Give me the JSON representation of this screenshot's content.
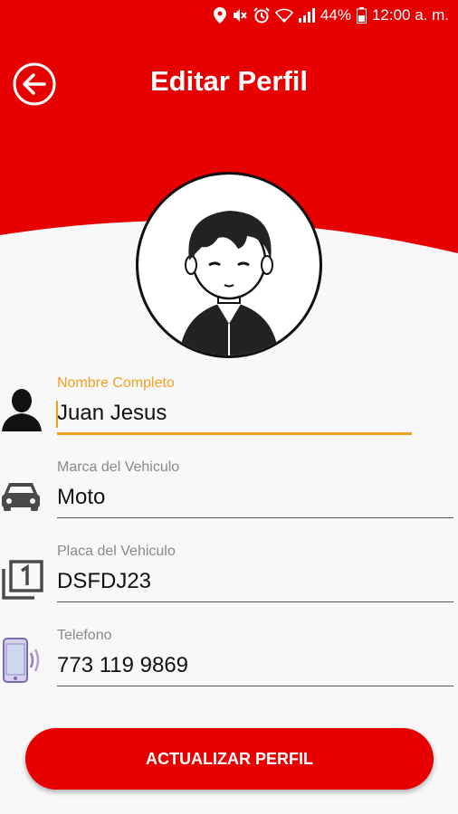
{
  "status_bar": {
    "battery": "44%",
    "time": "12:00 a. m.",
    "icons": [
      "location-icon",
      "mute-icon",
      "alarm-icon",
      "wifi-icon",
      "signal-icon",
      "battery-icon"
    ]
  },
  "header": {
    "title": "Editar Perfil",
    "back_icon": "back-arrow-icon",
    "background_color": "#e60000"
  },
  "form": {
    "fields": [
      {
        "label": "Nombre Completo",
        "value": "Juan Jesus",
        "icon": "person-icon",
        "active": true
      },
      {
        "label": "Marca del Vehiculo",
        "value": "Moto",
        "icon": "car-icon"
      },
      {
        "label": "Placa del Vehiculo",
        "value": "DSFDJ23",
        "icon": "plate-number-icon"
      },
      {
        "label": "Telefono",
        "value": "773 119 9869",
        "icon": "phone-icon"
      }
    ],
    "accent_color": "#f0a020"
  },
  "update_button": {
    "label": "ACTUALIZAR PERFIL"
  }
}
